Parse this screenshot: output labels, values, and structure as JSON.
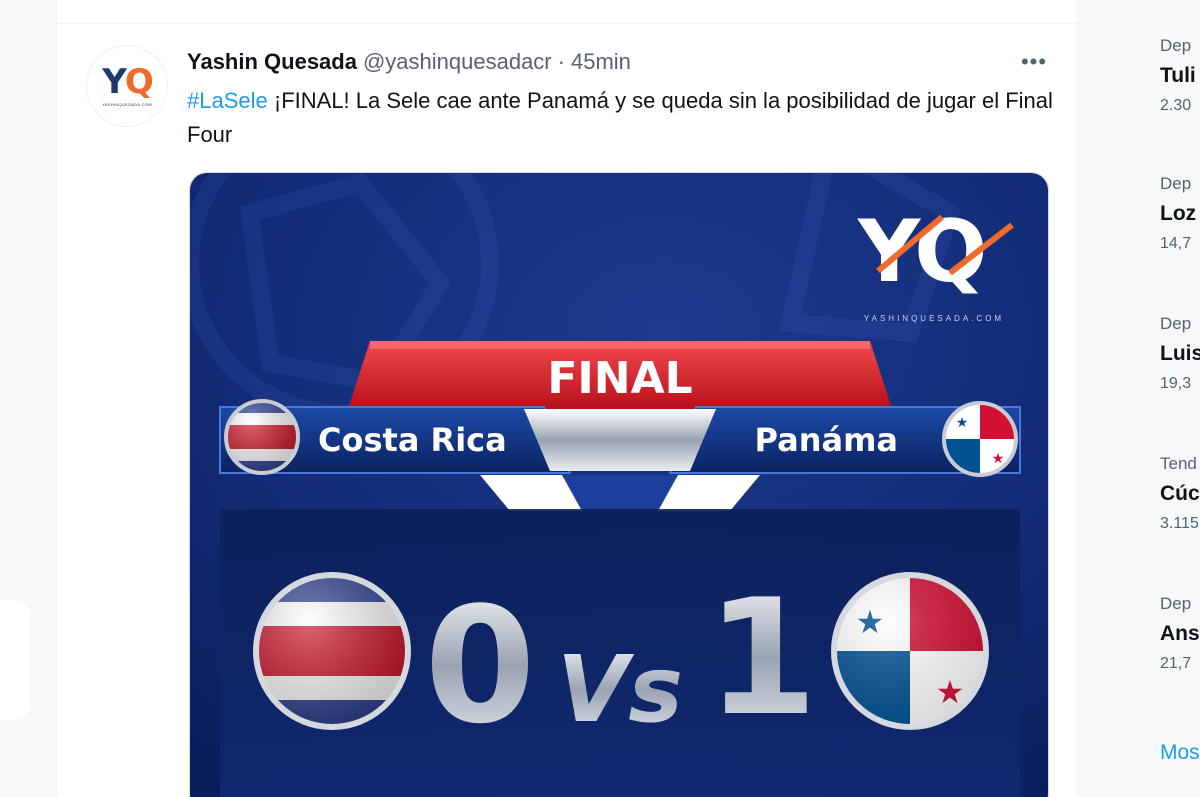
{
  "tweet": {
    "display_name": "Yashin Quesada",
    "handle": "@yashinquesadacr",
    "separator": "·",
    "time": "45min",
    "more_icon": "more-horizontal-icon",
    "more_glyph": "•••",
    "avatar": {
      "mark_left": "Y",
      "mark_right": "Q",
      "site": "YASHINQUESADA.COM"
    },
    "hashtag": "#LaSele",
    "text": "¡FINAL! La Sele cae ante Panamá y se queda sin la posibilidad de jugar el Final Four"
  },
  "scoreboard": {
    "logo_left": "Y",
    "logo_right": "Q",
    "logo_site": "YASHINQUESADA.COM",
    "banner": "FINAL",
    "home_team": "Costa Rica",
    "away_team": "Panáma",
    "home_score": "0",
    "away_score": "1",
    "versus": "Vs"
  },
  "sidebar": {
    "trends": [
      {
        "category": "Dep",
        "name": "Tuli",
        "count": "2.30"
      },
      {
        "category": "Dep",
        "name": "Loz",
        "count": "14,7"
      },
      {
        "category": "Dep",
        "name": "Luis",
        "count": "19,3"
      },
      {
        "category": "Tend",
        "name": "Cúc",
        "count": "3.115"
      },
      {
        "category": "Dep",
        "name": "Ans",
        "count": "21,7"
      }
    ],
    "show_more": "Mos"
  },
  "colors": {
    "link": "#1d9bf0",
    "text": "#0f1419",
    "muted": "#536471",
    "scoreboard_navy": "#0e2266",
    "banner_red": "#e4202a",
    "logo_orange": "#ef6a2b"
  }
}
